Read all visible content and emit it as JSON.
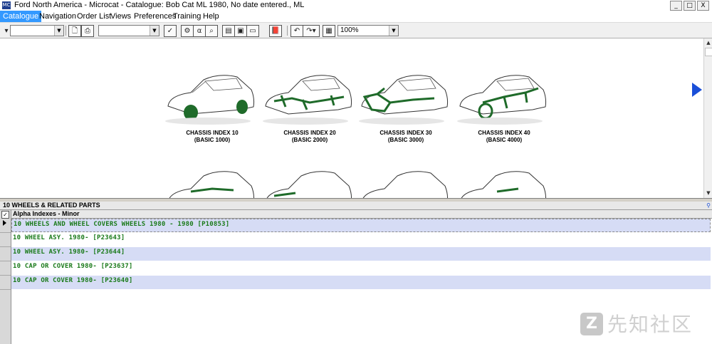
{
  "window": {
    "title": "Ford North America - Microcat - Catalogue: Bob Cat ML 1980, No date entered., ML",
    "buttons": {
      "minimize": "_",
      "maximize": "□",
      "close": "X"
    }
  },
  "menu": {
    "items": [
      "Catalogue",
      "Navigation",
      "Order List",
      "Views",
      "Preferences",
      "Training",
      "Help"
    ],
    "active": "Catalogue"
  },
  "toolbar": {
    "zoom": "100%",
    "icons": [
      "dropdown-left-icon",
      "preview-icon",
      "print-icon",
      "filter-icon",
      "search-vehicle-icon",
      "alpha-index-icon",
      "find-icon",
      "window-1-icon",
      "window-2-icon",
      "window-3-icon",
      "book-icon",
      "undo-icon",
      "redo-icon",
      "notes-icon"
    ]
  },
  "catalogue": {
    "cars": [
      {
        "label": "CHASSIS INDEX 10",
        "sub": "(BASIC 1000)"
      },
      {
        "label": "CHASSIS INDEX 20",
        "sub": "(BASIC 2000)"
      },
      {
        "label": "CHASSIS INDEX 30",
        "sub": "(BASIC 3000)"
      },
      {
        "label": "CHASSIS INDEX 40",
        "sub": "(BASIC 4000)"
      }
    ]
  },
  "section": {
    "title": "10   WHEELS & RELATED PARTS"
  },
  "grid": {
    "header": "Alpha Indexes - Minor",
    "rows": [
      "10  WHEELS AND WHEEL COVERS WHEELS 1980 - 1980 [P10853]",
      "10  WHEEL ASY. 1980- [P23643]",
      "10  WHEEL ASY. 1980- [P23644]",
      "10  CAP OR COVER 1980- [P23637]",
      "10  CAP OR COVER 1980- [P23640]"
    ]
  },
  "watermark": {
    "text": "先知社区"
  },
  "colors": {
    "accent": "#3399ff",
    "parts_green": "#1a7a1a",
    "row_shade": "#d6dcf5",
    "nav_arrow": "#1a4fd8"
  }
}
